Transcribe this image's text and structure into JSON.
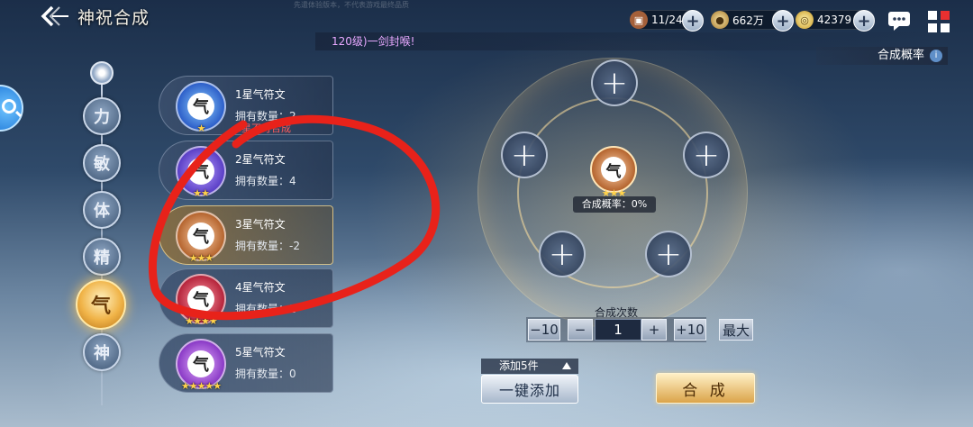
{
  "header": {
    "title": "神祝合成",
    "watermark": "先遣体验版本，不代表游戏最终品质"
  },
  "resources": [
    {
      "icon": "treasure-chest-icon",
      "value": "11/240"
    },
    {
      "icon": "coin-icon",
      "value": "662万"
    },
    {
      "icon": "dragon-token-icon",
      "value": "42379"
    }
  ],
  "notice": {
    "text": "120级)一剑封喉!"
  },
  "rate_button": {
    "label": "合成概率",
    "info": "i"
  },
  "tabs": [
    {
      "label": "力",
      "active": false
    },
    {
      "label": "敏",
      "active": false
    },
    {
      "label": "体",
      "active": false
    },
    {
      "label": "精",
      "active": false
    },
    {
      "label": "气",
      "active": true
    },
    {
      "label": "神",
      "active": false
    }
  ],
  "runes": [
    {
      "glyph": "气",
      "stars": "★",
      "name": "1星气符文",
      "count": "拥有数量：2",
      "warn": "1星不可合成",
      "color": "#2d5fc9"
    },
    {
      "glyph": "气",
      "stars": "★★",
      "name": "2星气符文",
      "count": "拥有数量：4",
      "warn": "",
      "color": "#5a3fc6"
    },
    {
      "glyph": "气",
      "stars": "★★★",
      "name": "3星气符文",
      "count": "拥有数量：-2",
      "warn": "",
      "color": "#b5652f"
    },
    {
      "glyph": "气",
      "stars": "★★★★",
      "name": "4星气符文",
      "count": "拥有数量：1",
      "warn": "",
      "color": "#b5243b"
    },
    {
      "glyph": "气",
      "stars": "★★★★★",
      "name": "5星气符文",
      "count": "拥有数量：0",
      "warn": "",
      "color": "#8a3ac6"
    }
  ],
  "synthesis": {
    "slot_symbol": "+",
    "center_glyph": "气",
    "center_stars": "★★★",
    "rate_text": "合成概率：0%"
  },
  "count_controls": {
    "label": "合成次数",
    "minus10": "−10",
    "minus1": "−",
    "value": "1",
    "plus1": "+",
    "plus10": "+10",
    "max": "最大"
  },
  "buttons": {
    "add5": "添加5件",
    "one_key_add": "一键添加",
    "synthesize": "合 成"
  },
  "colors": {
    "annotation": "#e8221a",
    "accent_gold": "#f0b347",
    "notice_text": "#e8a8ff"
  }
}
